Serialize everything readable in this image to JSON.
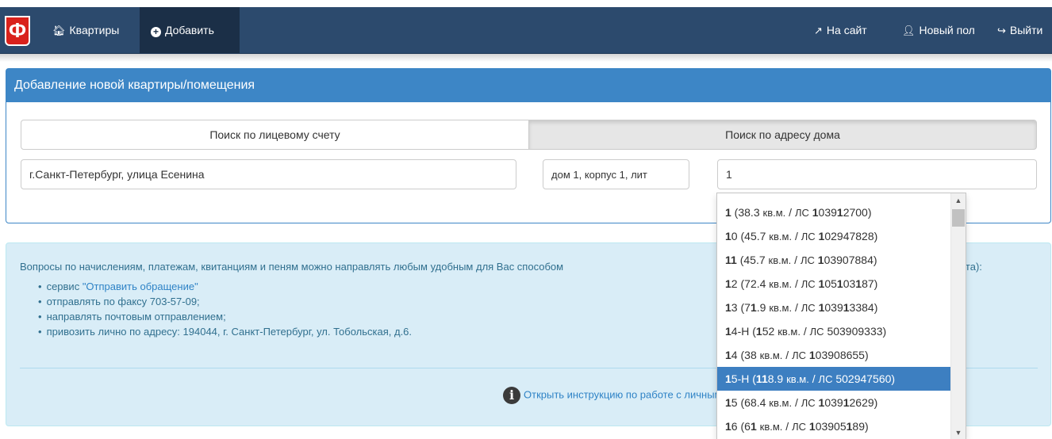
{
  "nav": {
    "logo": "Ф",
    "apartments": "Квартиры",
    "add": "Добавить",
    "to_site": "На сайт",
    "user": "Новый пол",
    "logout": "Выйти"
  },
  "panel": {
    "title": "Добавление новой квартиры/помещения",
    "tab_account": "Поиск по лицевому счету",
    "tab_address": "Поиск по адресу дома",
    "street_value": "г.Санкт-Петербург, улица Есенина",
    "house_value": "дом 1, корпус 1, лит",
    "apartment_value": "1"
  },
  "info": {
    "lead": "Вопросы по начислениям, платежам, квитанциям и пеням можно направлять любым удобным для Вас способом",
    "lead_tail": "счета):",
    "bullets": [
      {
        "prefix": "сервис ",
        "link": "\"Отправить обращение\""
      },
      {
        "text": "отправлять по факсу 703-57-09;"
      },
      {
        "text": "направлять почтовым отправлением;"
      },
      {
        "text": "привозить лично по адресу: 194044, г. Санкт-Петербург, ул. Тобольская, д.6."
      }
    ],
    "instruction_link": "Открыть инструкцию по работе с личным кабинетом."
  },
  "dropdown": {
    "highlighted_index": 7,
    "items": [
      {
        "num": "1",
        "area": "38.3",
        "account": "103912700"
      },
      {
        "num": "10",
        "area": "45.7",
        "account": "102947828"
      },
      {
        "num": "11",
        "area": "45.7",
        "account": "103907884"
      },
      {
        "num": "12",
        "area": "72.4",
        "account": "105103187"
      },
      {
        "num": "13",
        "area": "71.9",
        "account": "103913384"
      },
      {
        "num": "14-Н",
        "area": "152",
        "account": "503909333"
      },
      {
        "num": "14",
        "area": "38",
        "account": "103908655"
      },
      {
        "num": "15-Н",
        "area": "118.9",
        "account": "502947560"
      },
      {
        "num": "15",
        "area": "68.4",
        "account": "103912629"
      },
      {
        "num": "16",
        "area": "61",
        "account": "103905189"
      }
    ],
    "area_unit": "кв.м.",
    "account_prefix": "ЛС"
  }
}
